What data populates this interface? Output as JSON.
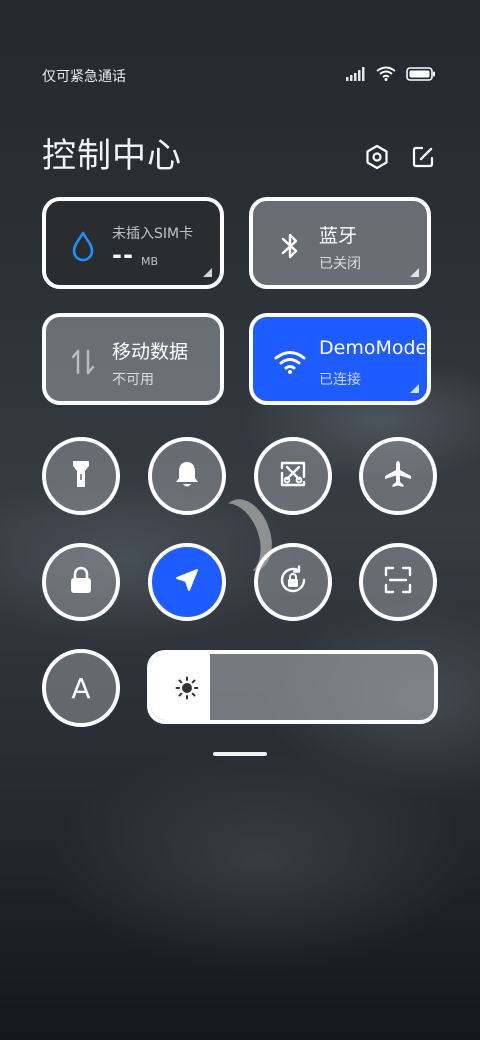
{
  "status_bar": {
    "carrier_text": "仅可紧急通话",
    "icons": [
      "signal-icon",
      "wifi-icon",
      "battery-icon"
    ]
  },
  "header": {
    "title": "控制中心",
    "buttons": [
      "settings-icon",
      "edit-icon"
    ]
  },
  "tiles": {
    "data_usage": {
      "label": "未插入SIM卡",
      "value": "--",
      "unit": "MB",
      "icon": "water-drop-icon",
      "accent": "#1e90ff"
    },
    "bluetooth": {
      "label": "蓝牙",
      "status": "已关闭",
      "icon": "bluetooth-icon"
    },
    "mobile_data": {
      "label": "移动数据",
      "status": "不可用",
      "icon": "data-arrows-icon"
    },
    "wifi": {
      "label": "DemoMode",
      "status": "已连接",
      "icon": "wifi-icon",
      "accent": "#1f5cff"
    }
  },
  "toggles": [
    {
      "name": "flashlight",
      "icon": "flashlight-icon",
      "active": false
    },
    {
      "name": "notifications",
      "icon": "bell-icon",
      "active": false
    },
    {
      "name": "screenshot",
      "icon": "screenshot-icon",
      "active": false
    },
    {
      "name": "airplane",
      "icon": "airplane-icon",
      "active": false
    },
    {
      "name": "lock-screen",
      "icon": "lock-icon",
      "active": false
    },
    {
      "name": "location",
      "icon": "location-arrow-icon",
      "active": true
    },
    {
      "name": "rotation-lock",
      "icon": "rotation-lock-icon",
      "active": false
    },
    {
      "name": "scanner",
      "icon": "scan-icon",
      "active": false
    }
  ],
  "auto_brightness": {
    "label": "A"
  },
  "brightness": {
    "level": 0.21,
    "icon": "sun-icon"
  }
}
